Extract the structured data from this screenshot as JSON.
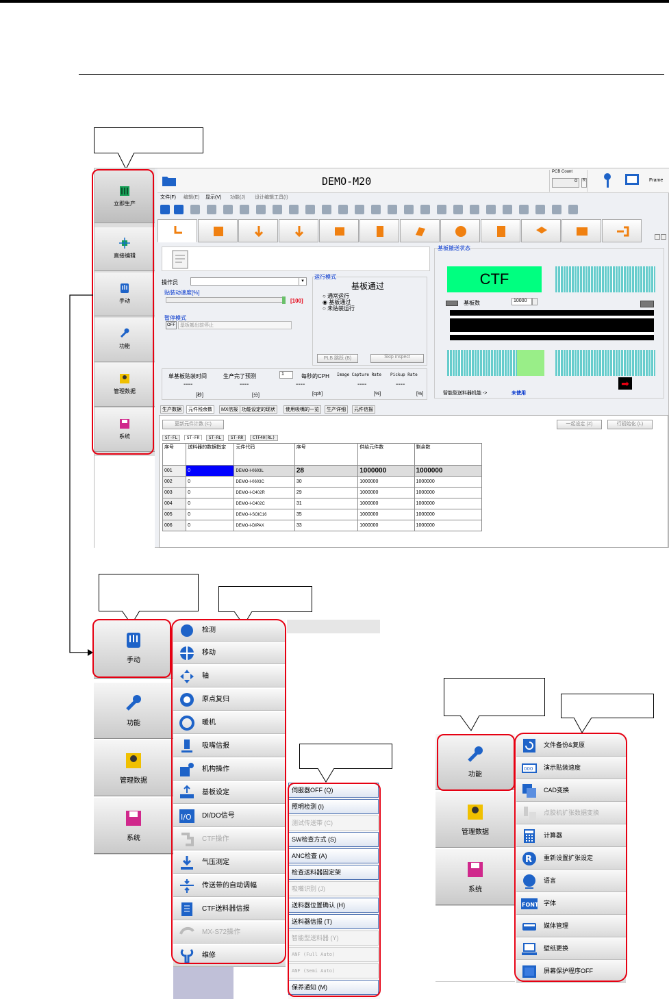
{
  "window": {
    "title": "DEMO-M20",
    "pcb_count_label": "PCB Count",
    "pcb_count_value": "0",
    "pcb_count_btn": "R",
    "frame_label": "Frame"
  },
  "menubar": [
    "文件(F)",
    "编辑(E)",
    "显示(V)",
    "功能(J)",
    "设计编辑工具(I)"
  ],
  "side_nav": [
    {
      "label": "立即生产",
      "icon": "board-icon"
    },
    {
      "label": "直接编辑",
      "icon": "chip-icon"
    },
    {
      "label": "手动",
      "icon": "hand-icon"
    },
    {
      "label": "功能",
      "icon": "wrench-icon"
    },
    {
      "label": "管理数据",
      "icon": "data-icon"
    },
    {
      "label": "系统",
      "icon": "disk-icon"
    }
  ],
  "left_panel": {
    "operator_label": "操作员",
    "speed_label": "贴装动速度[%]",
    "speed_value": "[100]",
    "pause_label": "暂停模式",
    "pause_off": "OFF",
    "pause_select": "基板搬出前停止",
    "run_mode_label": "运行模式",
    "run_mode_title": "基板通过",
    "run_modes": [
      "通常运行",
      "基板通过",
      "未贴装运行"
    ],
    "plb_btn": "PLB 跳跃 (B)",
    "skip_btn": "Skip inspect",
    "stats": [
      {
        "label": "单基板贴装时间",
        "value": "----",
        "unit": "[秒]"
      },
      {
        "label": "生产完了预测",
        "value": "----",
        "unit": "[分]"
      },
      {
        "label": "每秒的CPH",
        "value": "----",
        "unit": "[cph]"
      },
      {
        "label": "Image Capture Rate",
        "value": "----",
        "unit": "[%]"
      },
      {
        "label": "Pickup Rate",
        "value": "----",
        "unit": "[%]"
      }
    ],
    "spinner_value": "1"
  },
  "right_panel": {
    "title": "基板搬送状态",
    "ctf_label": "CTF",
    "board_count_label": "基板数",
    "board_count_value": "10000",
    "feeder_label": "智能型送料器机能 ->",
    "feeder_value": "未使用"
  },
  "bottom_tabs": [
    "生产数据",
    "元件残余数",
    "MX信报",
    "功能设定的现状",
    "使用吸嘴的一览",
    "生产详细",
    "元件信报"
  ],
  "bottom_toolbar": {
    "update_btn": "更新元件计数 (C)",
    "batch_btn": "一起设定 (Z)",
    "init_btn": "行初始化 (L)"
  },
  "subtabs": [
    "ST-FL",
    "ST-FR",
    "ST-RL",
    "ST-RR",
    "CTF40(RL)"
  ],
  "table": {
    "headers": [
      "序号",
      "送料器的数据指定",
      "元件代码",
      "序号",
      "供给元件数",
      "剩余数"
    ],
    "rows": [
      [
        "001",
        "0",
        "DEMO-I-0603L",
        "28",
        "1000000",
        "1000000"
      ],
      [
        "002",
        "0",
        "DEMO-I-0603C",
        "30",
        "1000000",
        "1000000"
      ],
      [
        "003",
        "0",
        "DEMO-I-C402R",
        "29",
        "1000000",
        "1000000"
      ],
      [
        "004",
        "0",
        "DEMO-I-C402C",
        "31",
        "1000000",
        "1000000"
      ],
      [
        "005",
        "0",
        "DEMO-I-SOIC16",
        "35",
        "1000000",
        "1000000"
      ],
      [
        "006",
        "0",
        "DEMO-I-DIPAX",
        "33",
        "1000000",
        "1000000"
      ]
    ]
  },
  "manual_side": [
    {
      "label": "手动",
      "icon": "hand-icon"
    },
    {
      "label": "功能",
      "icon": "wrench-icon"
    },
    {
      "label": "管理数据",
      "icon": "data-icon"
    },
    {
      "label": "系统",
      "icon": "disk-icon"
    }
  ],
  "manual_menu": [
    {
      "label": "检测",
      "icon": "detect-icon",
      "enabled": true
    },
    {
      "label": "移动",
      "icon": "move-icon",
      "enabled": true
    },
    {
      "label": "轴",
      "icon": "axis-icon",
      "enabled": true
    },
    {
      "label": "原点复归",
      "icon": "origin-icon",
      "enabled": true
    },
    {
      "label": "暖机",
      "icon": "warmup-icon",
      "enabled": true
    },
    {
      "label": "吸嘴信报",
      "icon": "nozzle-icon",
      "enabled": true
    },
    {
      "label": "机构操作",
      "icon": "mechanism-icon",
      "enabled": true
    },
    {
      "label": "基板设定",
      "icon": "board-set-icon",
      "enabled": true
    },
    {
      "label": "DI/DO信号",
      "icon": "io-icon",
      "enabled": true
    },
    {
      "label": "CTF操作",
      "icon": "ctf-icon",
      "enabled": false
    },
    {
      "label": "气压测定",
      "icon": "pressure-icon",
      "enabled": true
    },
    {
      "label": "传送带的自动调幅",
      "icon": "conveyor-icon",
      "enabled": true
    },
    {
      "label": "CTF送料器信报",
      "icon": "ctf-feeder-icon",
      "enabled": true
    },
    {
      "label": "MX-S72操作",
      "icon": "mx-icon",
      "enabled": false
    },
    {
      "label": "维修",
      "icon": "maintenance-icon",
      "enabled": true
    }
  ],
  "sub_menu": [
    {
      "label": "伺服器OFF (Q)",
      "enabled": true
    },
    {
      "label": "照明检测 (I)",
      "enabled": true
    },
    {
      "label": "测试传送带 (C)",
      "enabled": false
    },
    {
      "label": "SW检查方式 (S)",
      "enabled": true
    },
    {
      "label": "ANC检查 (A)",
      "enabled": true
    },
    {
      "label": "检查送料器固定架",
      "enabled": true
    },
    {
      "label": "吸嘴识别 (J)",
      "enabled": false
    },
    {
      "label": "送料器位置确认 (H)",
      "enabled": true
    },
    {
      "label": "送料器信报 (T)",
      "enabled": true
    },
    {
      "label": "智能型送料器 (Y)",
      "enabled": false
    },
    {
      "label": "ANF (Full Auto)",
      "enabled": false
    },
    {
      "label": "ANF (Semi Auto)",
      "enabled": false
    },
    {
      "label": "保养通知 (M)",
      "enabled": true
    }
  ],
  "function_side": [
    {
      "label": "功能",
      "icon": "wrench-icon"
    },
    {
      "label": "管理数据",
      "icon": "data-icon"
    },
    {
      "label": "系统",
      "icon": "disk-icon"
    }
  ],
  "function_menu": [
    {
      "label": "文件备份&复原",
      "icon": "backup-icon",
      "enabled": true
    },
    {
      "label": "演示贴装速度",
      "icon": "demo-speed-icon",
      "enabled": true
    },
    {
      "label": "CAD变换",
      "icon": "cad-icon",
      "enabled": true
    },
    {
      "label": "点胶机扩张数据变换",
      "icon": "dispenser-icon",
      "enabled": false
    },
    {
      "label": "计算器",
      "icon": "calculator-icon",
      "enabled": true
    },
    {
      "label": "重新设置扩张设定",
      "icon": "reset-icon",
      "enabled": true
    },
    {
      "label": "语言",
      "icon": "globe-icon",
      "enabled": true
    },
    {
      "label": "字体",
      "icon": "font-icon",
      "enabled": true
    },
    {
      "label": "媒体管理",
      "icon": "media-icon",
      "enabled": true
    },
    {
      "label": "壁纸更换",
      "icon": "wallpaper-icon",
      "enabled": true
    },
    {
      "label": "屏幕保护程序OFF",
      "icon": "screensaver-icon",
      "enabled": true
    }
  ],
  "colors": {
    "accent": "#e60012",
    "ctf_green": "#00ff80",
    "stripe": "#66cccc",
    "link": "#0033cc"
  }
}
